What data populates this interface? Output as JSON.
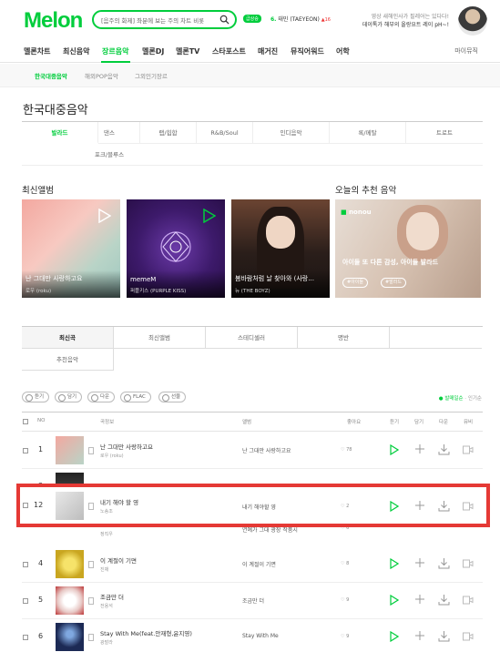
{
  "header": {
    "logo": "Melon",
    "search_value": "[음주의 화제] 좌분에 보는 주의 차트 비롯",
    "chart_badge": "급상승",
    "rank_num": "6.",
    "rank_song": "태민 (TAEYEON)",
    "rank_change": "▲16",
    "promo_line1": "영상 새해인사가 필레어는 있다다!",
    "promo_line2": "데이톡가 해부의 올랑요트 레이 pH~!"
  },
  "gnb": {
    "items": [
      "멜론차트",
      "최신음악",
      "장르음악",
      "멜론DJ",
      "멜론TV",
      "스타포스트",
      "매거진",
      "뮤직어워드",
      "어학"
    ],
    "mymusic": "마이뮤직"
  },
  "subnav": {
    "items": [
      "한국대중음악",
      "해외POP음악",
      "그외인기장르"
    ]
  },
  "page_title": "한국대중음악",
  "genres": {
    "row1": [
      "발라드",
      "댄스",
      "랩/힙합",
      "R&B/Soul",
      "인디음악",
      "록/메탈",
      "트로트"
    ],
    "row2": [
      "포크/블루스"
    ]
  },
  "sections": {
    "new_albums": "최신앨범",
    "recommend": "오늘의 추천 음악"
  },
  "albums": [
    {
      "title": "난 그대만 사랑하고요",
      "artist": "로우 (roku)"
    },
    {
      "title": "memeM",
      "artist": "퍼플키스 (PURPLE KISS)"
    },
    {
      "title": "봄바람처럼 날 찾아와 (사랑...",
      "artist": "뉴 (THE BOYZ)"
    }
  ],
  "recommend": {
    "brand": "nonou",
    "text": "아이들 또 다른 감성, 아이들 발라드",
    "tags": [
      "#아이들",
      "#발라드"
    ]
  },
  "tabs": {
    "row1": [
      "최신곡",
      "최신앨범",
      "스테디셀러",
      "명반"
    ],
    "row2": [
      "추천음악"
    ]
  },
  "chips": [
    "듣기",
    "담기",
    "다운",
    "FLAC",
    "선물"
  ],
  "sort": {
    "active": "● 발매일순",
    "other": "인기순"
  },
  "list_head": {
    "no": "NO",
    "song": "곡정보",
    "album": "앨범",
    "like": "좋아요",
    "listen": "듣기",
    "add": "담기",
    "down": "다운",
    "mv": "뮤비"
  },
  "songs": [
    {
      "rank": "1",
      "title": "난 그대만 사랑하고요",
      "artist": "로우 (roku)",
      "album": "난 그대만 사랑하고요",
      "like": "♡ 78"
    },
    {
      "rank": "3",
      "title": "",
      "artist": "정직우",
      "album": "연예가 그대 광장 작품시",
      "like": "♡ 6"
    },
    {
      "rank": "4",
      "title": "이 계절이 기면",
      "artist": "진채",
      "album": "이 계절이 기면",
      "like": "♡ 8"
    },
    {
      "rank": "5",
      "title": "조금만 더",
      "artist": "전용석",
      "album": "조금만 더",
      "like": "♡ 9"
    },
    {
      "rank": "6",
      "title": "Stay With Me(feat.안재형,윤지영)",
      "artist": "광발라",
      "album": "Stay With Me",
      "like": "♡ 9"
    }
  ],
  "highlight_song": {
    "rank": "12",
    "title": "내기 해야 할 영",
    "artist": "노송조",
    "album": "내기 해야할 영",
    "like": "♡ 2"
  },
  "colors": {
    "brand": "#00cd3c",
    "highlight": "#e53935"
  }
}
